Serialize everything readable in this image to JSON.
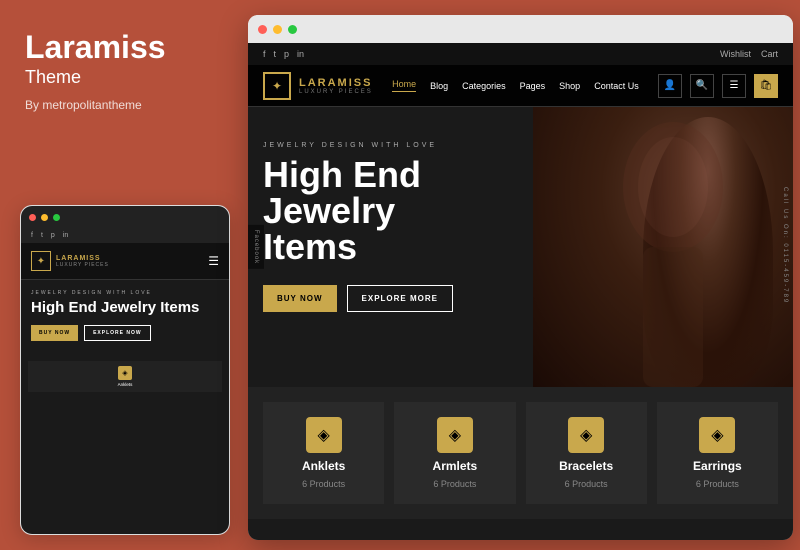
{
  "left_panel": {
    "title": "Laramiss",
    "subtitle": "Theme",
    "author": "By metropolitantheme"
  },
  "mobile": {
    "social_icons": [
      "f",
      "t",
      "p",
      "in"
    ],
    "nav": {
      "logo_text": "LARAMISS",
      "logo_sub": "LUXURY PIECES"
    },
    "hero": {
      "tag": "JEWELRY DESIGN WITH LOVE",
      "title": "High End Jewelry Items",
      "btn_primary": "BUY NOW",
      "btn_secondary": "EXPLORE NOW"
    }
  },
  "desktop": {
    "top_bar": {
      "social_icons": [
        "f",
        "t",
        "p",
        "in"
      ],
      "wishlist": "Wishlist",
      "cart": "Cart"
    },
    "nav": {
      "logo_text": "LARAMISS",
      "logo_sub": "LUXURY PIECES",
      "links": [
        {
          "label": "Home",
          "active": true
        },
        {
          "label": "Blog",
          "active": false
        },
        {
          "label": "Categories",
          "active": false
        },
        {
          "label": "Pages",
          "active": false
        },
        {
          "label": "Shop",
          "active": false
        },
        {
          "label": "Contact Us",
          "active": false
        }
      ],
      "icons": [
        "person",
        "search",
        "menu",
        "cart"
      ]
    },
    "hero": {
      "tag": "JEWELRY DESIGN WITH LOVE",
      "title": "High End\nJewelry\nItems",
      "btn_primary": "BUY NOW",
      "btn_secondary": "EXPLORE MORE",
      "side_text": "Call Us On: 0115-459-789",
      "left_social": "Facebook"
    },
    "categories": [
      {
        "name": "Anklets",
        "count": "6 Products",
        "icon": "◈"
      },
      {
        "name": "Armlets",
        "count": "6 Products",
        "icon": "◈"
      },
      {
        "name": "Bracelets",
        "count": "6 Products",
        "icon": "◈"
      },
      {
        "name": "Earrings",
        "count": "6 Products",
        "icon": "◈"
      }
    ]
  },
  "colors": {
    "gold": "#c9a84c",
    "dark_bg": "#1a1a1a",
    "rust": "#b5503a"
  }
}
